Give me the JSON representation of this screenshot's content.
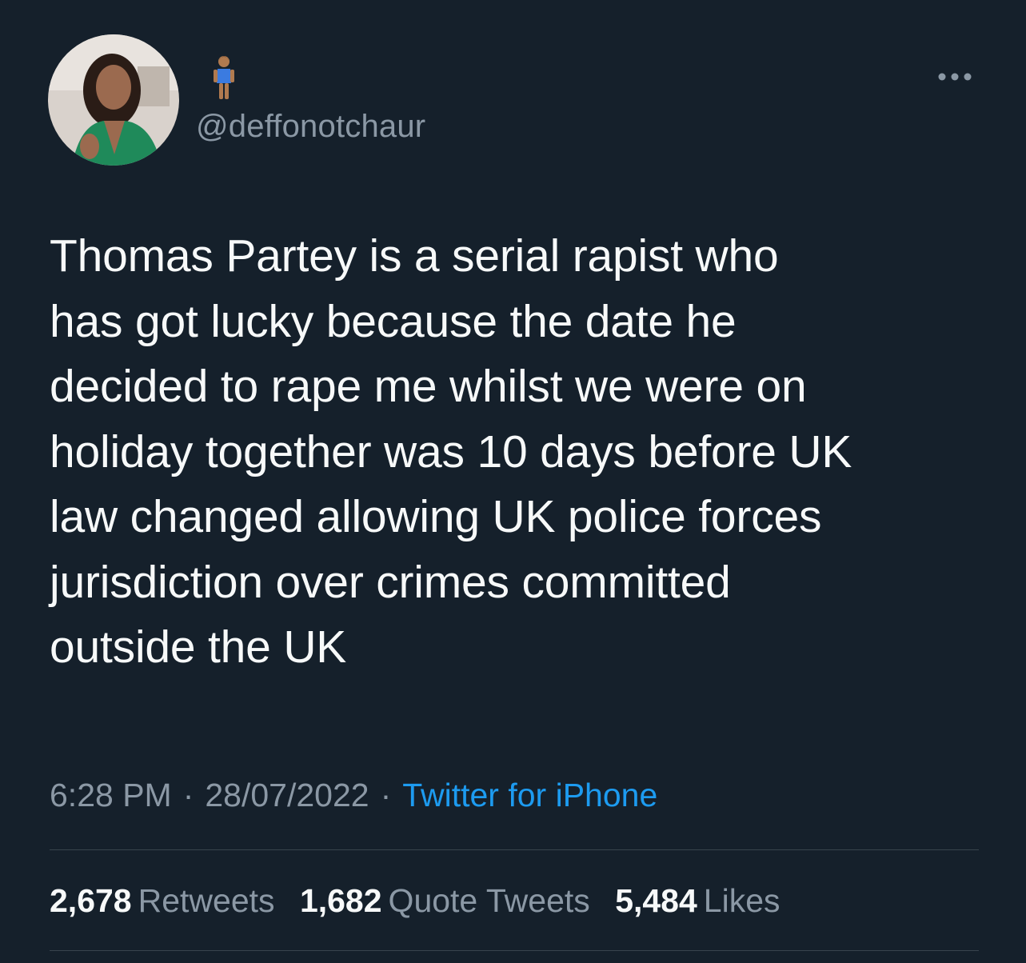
{
  "tweet": {
    "author": {
      "handle": "@deffonotchaur",
      "display_name_emoji": "standing-woman-emoji"
    },
    "text_lines": [
      "Thomas Partey is a serial rapist who",
      "has got lucky because the date he",
      "decided to rape me whilst we were on",
      "holiday together was 10 days before UK",
      "law changed allowing UK police forces",
      "jurisdiction over crimes committed",
      "outside the UK"
    ],
    "meta": {
      "time": "6:28 PM",
      "separator": "·",
      "date": "28/07/2022",
      "source": "Twitter for iPhone"
    },
    "stats": {
      "retweets_count": "2,678",
      "retweets_label": "Retweets",
      "quotes_count": "1,682",
      "quotes_label": "Quote Tweets",
      "likes_count": "5,484",
      "likes_label": "Likes"
    }
  },
  "icons": {
    "more": "more-horizontal-icon"
  },
  "colors": {
    "background": "#15202b",
    "text": "#f7f9f9",
    "secondary": "#8b98a5",
    "link": "#1d9bf0",
    "divider": "#38444d"
  }
}
